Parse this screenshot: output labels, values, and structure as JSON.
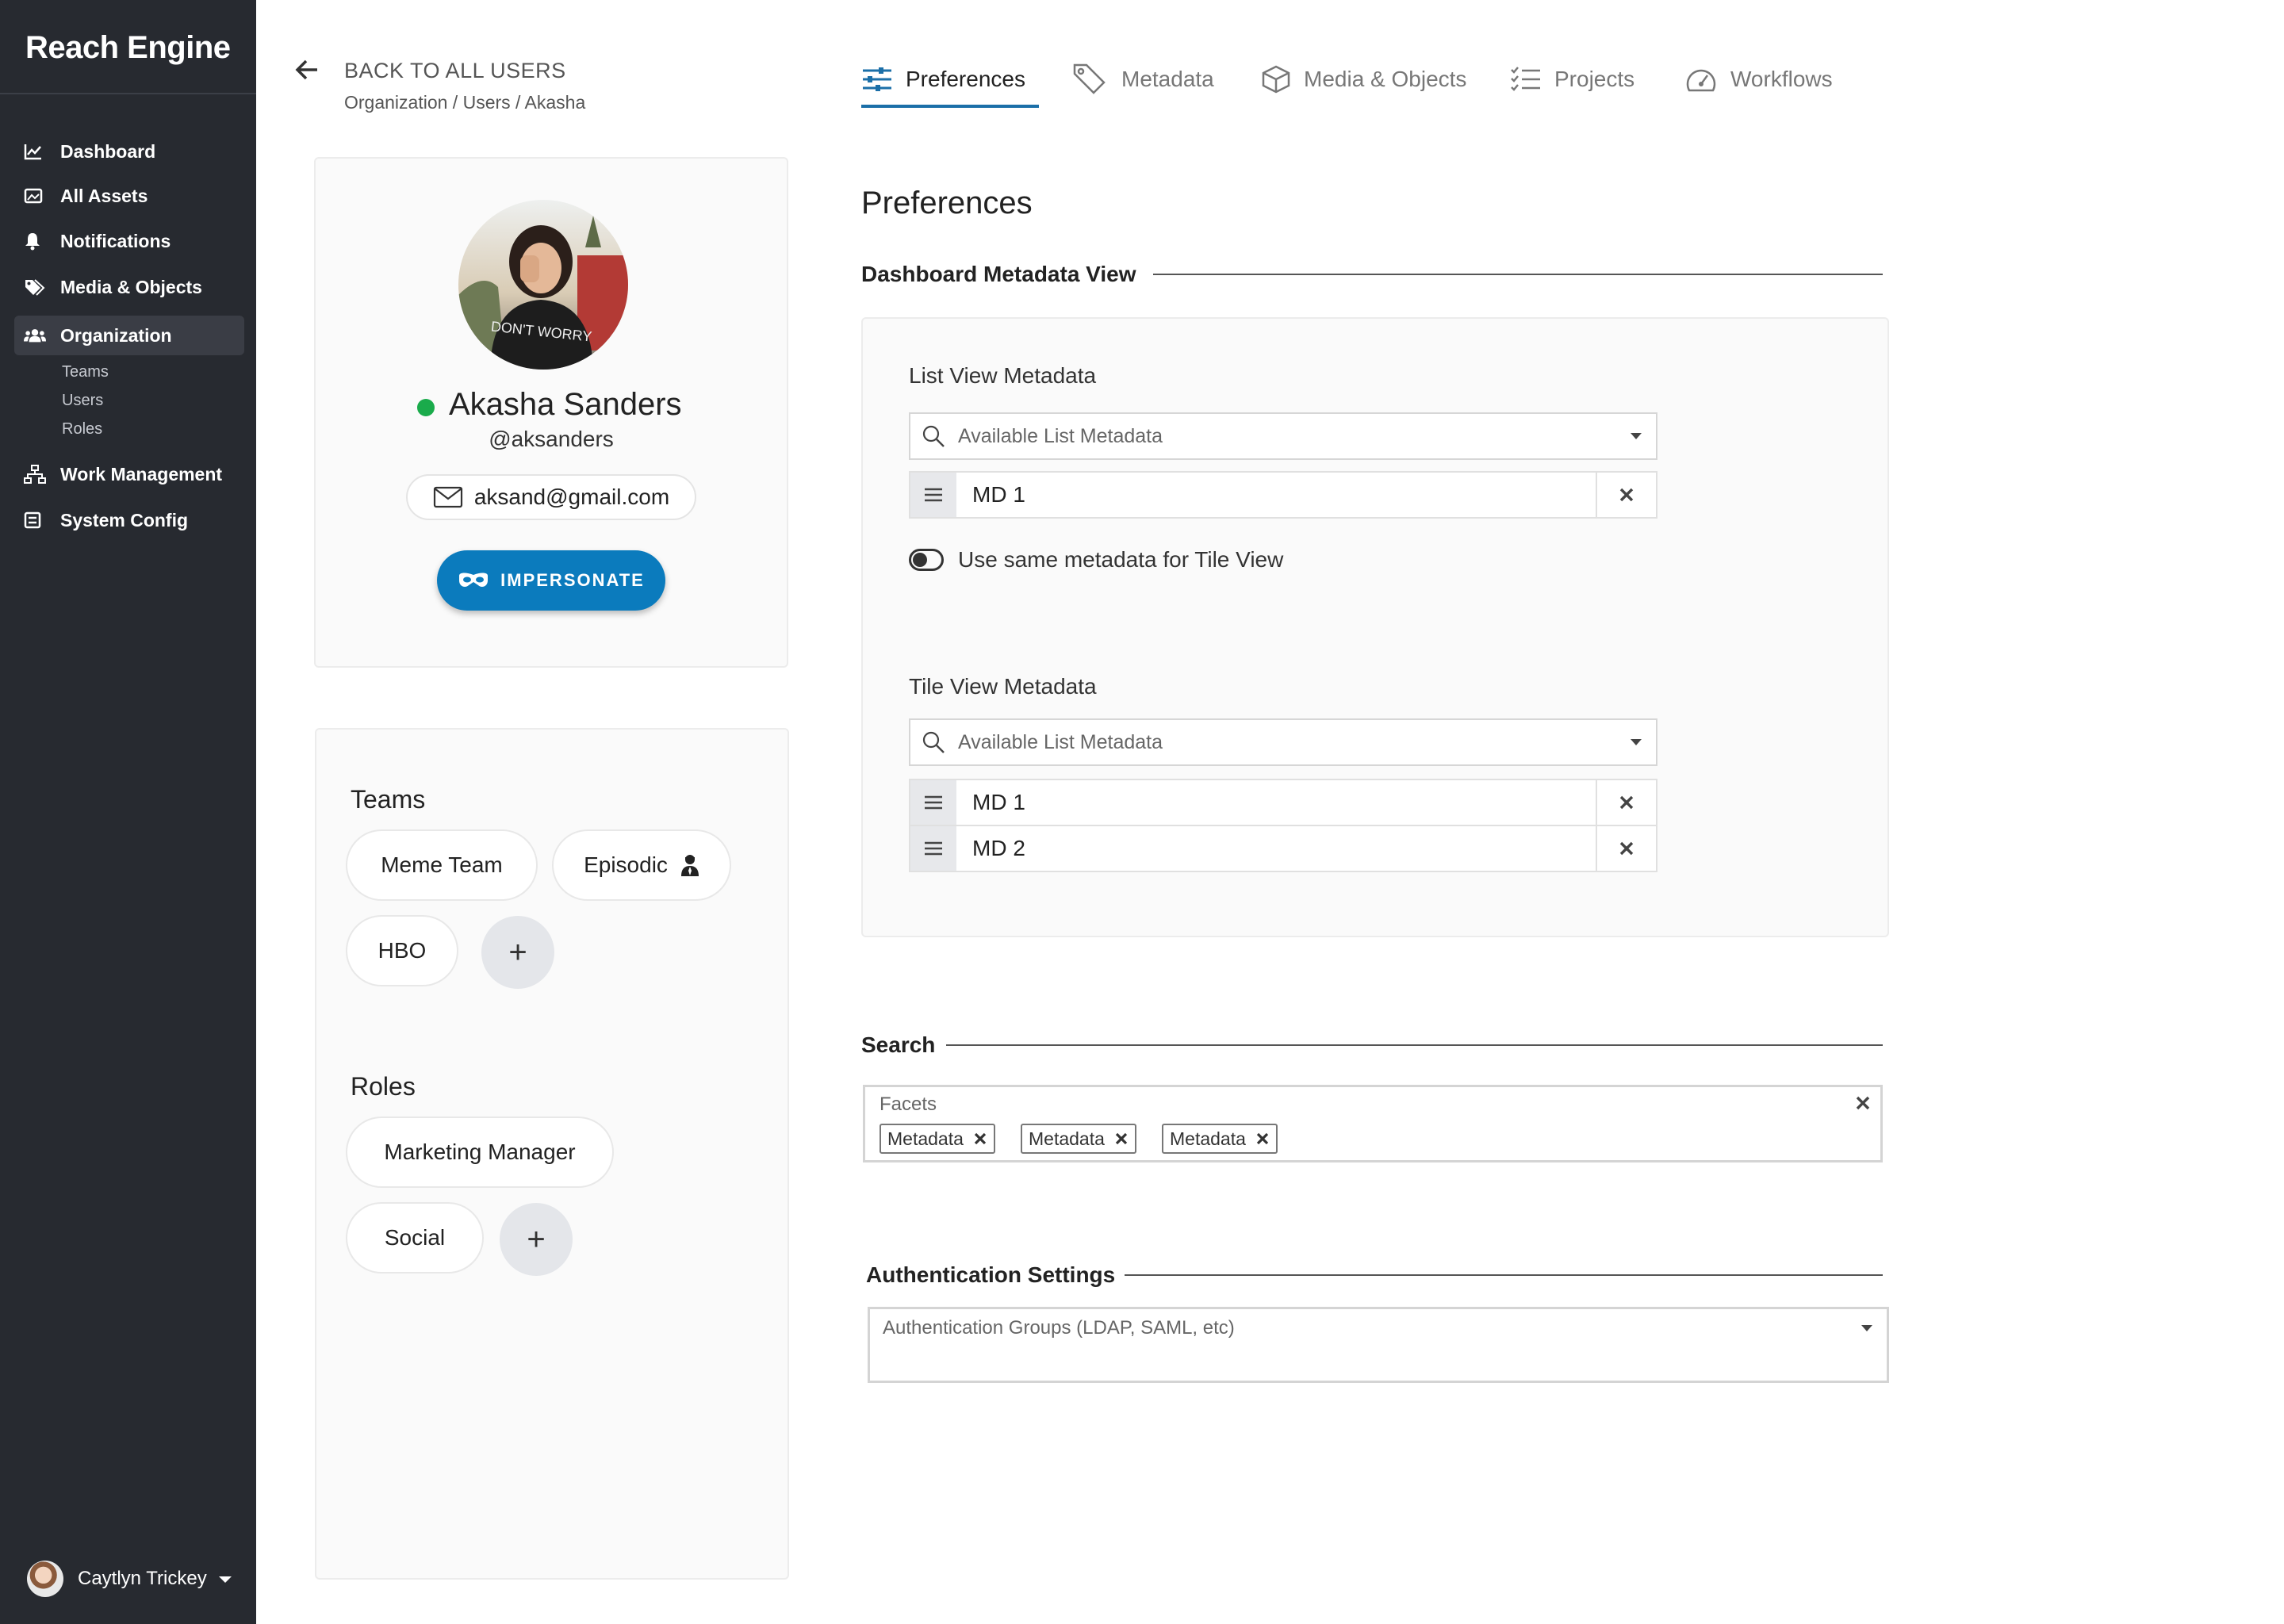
{
  "app": {
    "brand": "Reach Engine"
  },
  "sidebar": {
    "items": [
      {
        "label": "Dashboard",
        "icon": "chart-icon"
      },
      {
        "label": "All Assets",
        "icon": "image-icon"
      },
      {
        "label": "Notifications",
        "icon": "bell-icon"
      },
      {
        "label": "Media & Objects",
        "icon": "tags-icon"
      },
      {
        "label": "Organization",
        "icon": "users-icon",
        "active": true
      },
      {
        "label": "Work Management",
        "icon": "sitemap-icon"
      },
      {
        "label": "System Config",
        "icon": "config-icon"
      }
    ],
    "sub_items": [
      "Teams",
      "Users",
      "Roles"
    ],
    "user": {
      "name": "Caytlyn Trickey"
    }
  },
  "header": {
    "back_label": "BACK TO ALL USERS",
    "breadcrumb": "Organization / Users / Akasha",
    "tabs": [
      {
        "label": "Preferences",
        "icon": "sliders-icon",
        "active": true
      },
      {
        "label": "Metadata",
        "icon": "tag-icon"
      },
      {
        "label": "Media & Objects",
        "icon": "cube-icon"
      },
      {
        "label": "Projects",
        "icon": "checklist-icon"
      },
      {
        "label": "Workflows",
        "icon": "gauge-icon"
      }
    ]
  },
  "profile": {
    "name": "Akasha Sanders",
    "handle": "@aksanders",
    "email": "aksand@gmail.com",
    "impersonate_label": "IMPERSONATE",
    "status_color": "#1aab4b",
    "shirt_text": "DON'T WORRY"
  },
  "teams": {
    "title": "Teams",
    "items": [
      "Meme Team",
      "Episodic",
      "HBO"
    ],
    "add_label": "+"
  },
  "roles": {
    "title": "Roles",
    "items": [
      "Marketing Manager",
      "Social"
    ],
    "add_label": "+"
  },
  "preferences": {
    "title": "Preferences",
    "dashboard_section": "Dashboard Metadata View",
    "list_view": {
      "label": "List View Metadata",
      "placeholder": "Available List Metadata",
      "items": [
        "MD 1"
      ]
    },
    "toggle_label": "Use same metadata for Tile View",
    "toggle_on": false,
    "tile_view": {
      "label": "Tile View Metadata",
      "placeholder": "Available List Metadata",
      "items": [
        "MD 1",
        "MD 2"
      ]
    },
    "search_section": "Search",
    "facets": {
      "label": "Facets",
      "tags": [
        "Metadata",
        "Metadata",
        "Metadata"
      ]
    },
    "auth_section": "Authentication Settings",
    "auth_placeholder": "Authentication Groups (LDAP, SAML, etc)"
  },
  "colors": {
    "sidebar_bg": "#272a30",
    "accent": "#0b7bbd",
    "tab_underline": "#1b6fa8",
    "online": "#1aab4b"
  }
}
